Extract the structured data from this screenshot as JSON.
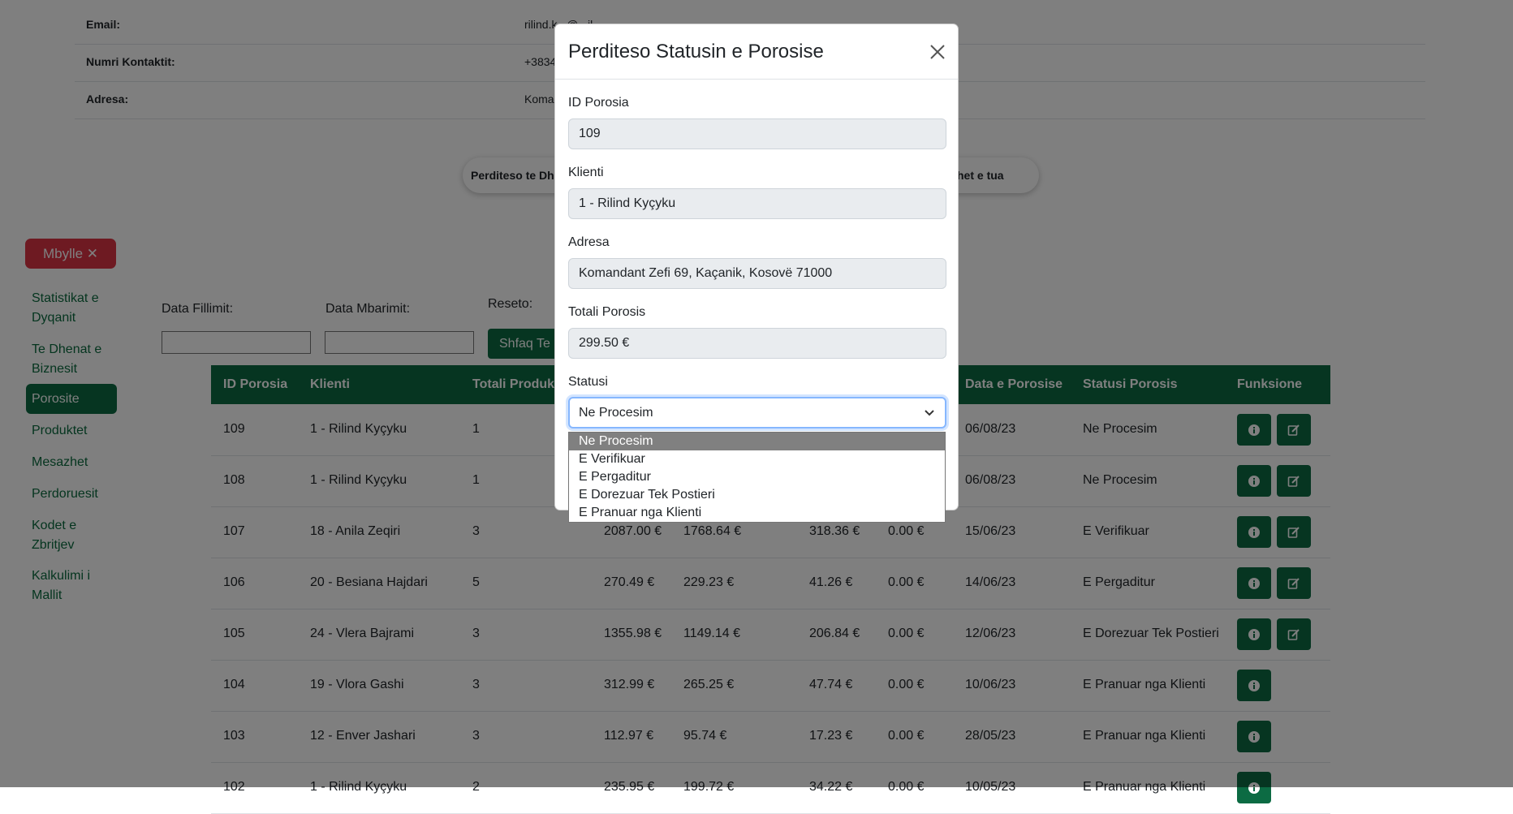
{
  "profile": {
    "email_label": "Email:",
    "email_value": "rilind.k...@...il...",
    "phone_label": "Numri Kontaktit:",
    "phone_value": "+3834",
    "address_label": "Adresa:",
    "address_value": "Koma"
  },
  "pill": {
    "left_label": "Perditeso te Dh",
    "right_label": "zhet e tua"
  },
  "sidebar": {
    "close_label": "Mbylle ✕",
    "items": [
      {
        "label": "Statistikat e Dyqanit"
      },
      {
        "label": "Te Dhenat e Biznesit"
      },
      {
        "label": "Porosite"
      },
      {
        "label": "Produktet"
      },
      {
        "label": "Mesazhet"
      },
      {
        "label": "Perdoruesit"
      },
      {
        "label": "Kodet e Zbritjev"
      },
      {
        "label": "Kalkulimi i Mallit"
      }
    ]
  },
  "filters": {
    "start_label": "Data Fillimit:",
    "end_label": "Data Mbarimit:",
    "reset_label": "Reseto:",
    "show_button": "Shfaq Te G"
  },
  "table": {
    "headers": [
      "ID Porosia",
      "Klienti",
      "Totali Produk",
      "Data e Porosise",
      "Statusi Porosis",
      "Funksione"
    ],
    "rows": [
      {
        "id": "109",
        "client": "1 - Rilind Kyçyku",
        "qty": "1",
        "total": "",
        "sub": "",
        "tax": "",
        "disc": "",
        "date": "06/08/23",
        "status": "Ne Procesim",
        "editable": true
      },
      {
        "id": "108",
        "client": "1 - Rilind Kyçyku",
        "qty": "1",
        "total": "",
        "sub": "",
        "tax": "",
        "disc": "",
        "date": "06/08/23",
        "status": "Ne Procesim",
        "editable": true
      },
      {
        "id": "107",
        "client": "18 - Anila Zeqiri",
        "qty": "3",
        "total": "2087.00 €",
        "sub": "1768.64 €",
        "tax": "318.36 €",
        "disc": "0.00 €",
        "date": "15/06/23",
        "status": "E Verifikuar",
        "editable": true
      },
      {
        "id": "106",
        "client": "20 - Besiana Hajdari",
        "qty": "5",
        "total": "270.49 €",
        "sub": "229.23 €",
        "tax": "41.26 €",
        "disc": "0.00 €",
        "date": "14/06/23",
        "status": "E Pergaditur",
        "editable": true
      },
      {
        "id": "105",
        "client": "24 - Vlera Bajrami",
        "qty": "3",
        "total": "1355.98 €",
        "sub": "1149.14 €",
        "tax": "206.84 €",
        "disc": "0.00 €",
        "date": "12/06/23",
        "status": "E Dorezuar Tek Postieri",
        "editable": true
      },
      {
        "id": "104",
        "client": "19 - Vlora Gashi",
        "qty": "3",
        "total": "312.99 €",
        "sub": "265.25 €",
        "tax": "47.74 €",
        "disc": "0.00 €",
        "date": "10/06/23",
        "status": "E Pranuar nga Klienti",
        "editable": false
      },
      {
        "id": "103",
        "client": "12 - Enver Jashari",
        "qty": "3",
        "total": "112.97 €",
        "sub": "95.74 €",
        "tax": "17.23 €",
        "disc": "0.00 €",
        "date": "28/05/23",
        "status": "E Pranuar nga Klienti",
        "editable": false
      },
      {
        "id": "102",
        "client": "1 - Rilind Kyçyku",
        "qty": "2",
        "total": "235.95 €",
        "sub": "199.72 €",
        "tax": "34.22 €",
        "disc": "0.00 €",
        "date": "10/05/23",
        "status": "E Pranuar nga Klienti",
        "editable": false
      }
    ]
  },
  "modal": {
    "title": "Perditeso Statusin e Porosise",
    "id_label": "ID Porosia",
    "id_value": "109",
    "client_label": "Klienti",
    "client_value": "1 - Rilind Kyçyku",
    "address_label": "Adresa",
    "address_value": "Komandant Zefi 69, Kaçanik, Kosovë 71000",
    "total_label": "Totali Porosis",
    "total_value": "299.50 €",
    "status_label": "Statusi",
    "status_value": "Ne Procesim",
    "status_options": [
      "Ne Procesim",
      "E Verifikuar",
      "E Pergaditur",
      "E Dorezuar Tek Postieri",
      "E Pranuar nga Klienti"
    ]
  },
  "colors": {
    "brand_green": "#0c6b43",
    "danger_red": "#dc3545"
  },
  "icons": {
    "info": "info-icon",
    "edit": "edit-icon",
    "close": "close-icon",
    "chevron": "chevron-down-icon"
  }
}
